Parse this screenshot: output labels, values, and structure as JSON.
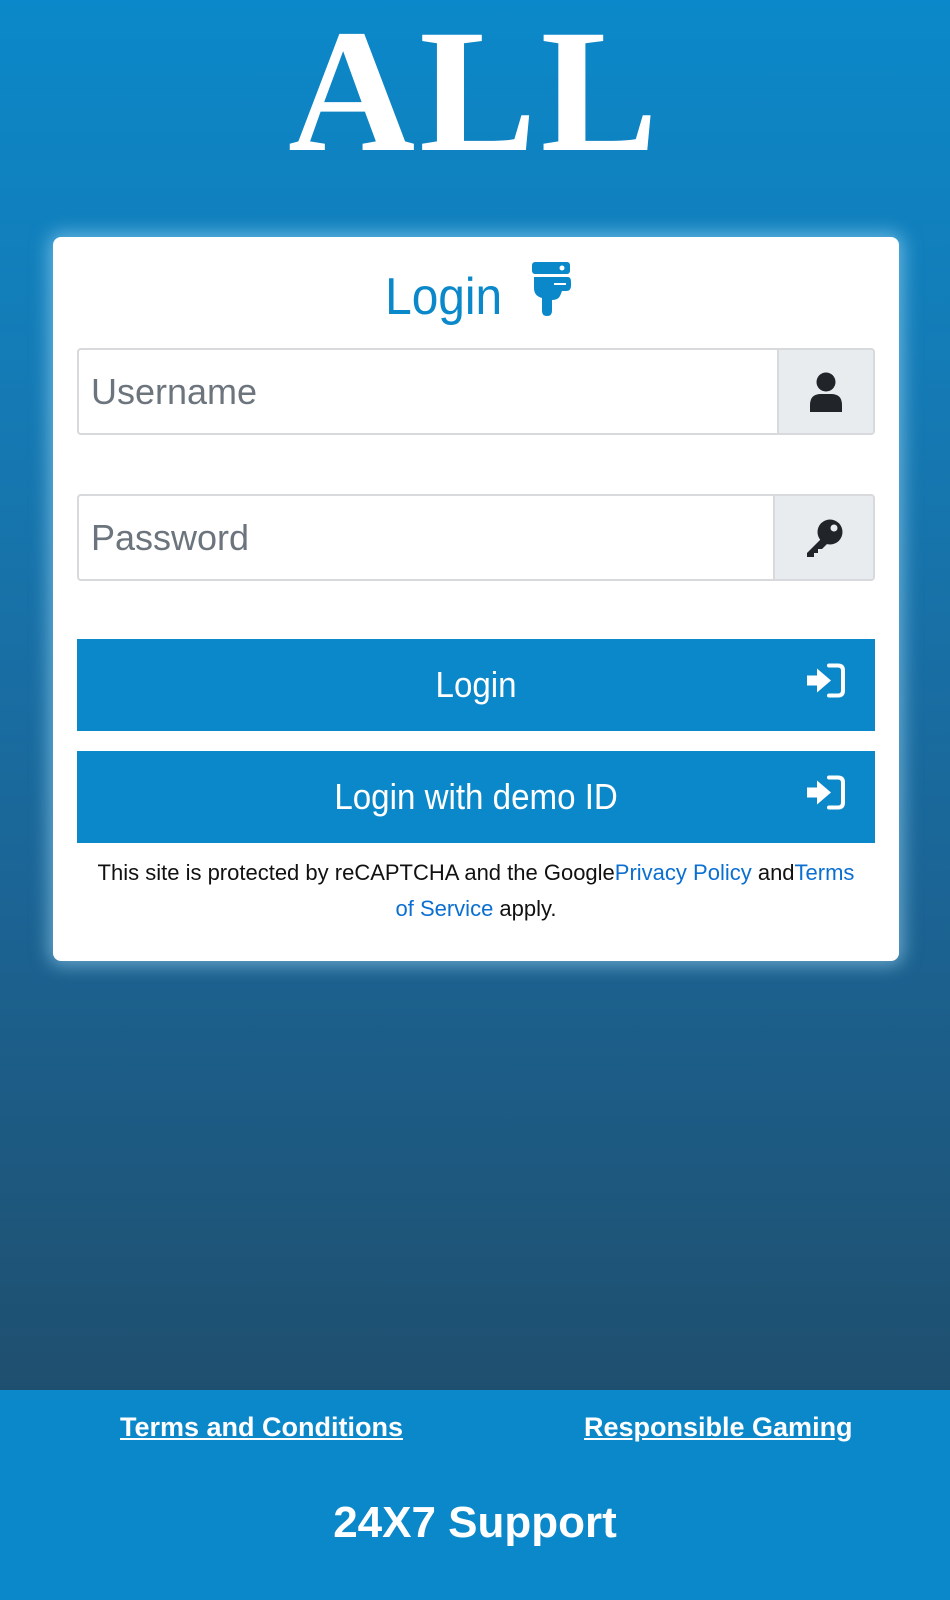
{
  "logo": {
    "text": "ALL"
  },
  "login_card": {
    "title": "Login",
    "title_icon": "hand-point-down-icon",
    "username": {
      "placeholder": "Username",
      "value": "",
      "icon": "user-icon"
    },
    "password": {
      "placeholder": "Password",
      "value": "",
      "icon": "key-icon"
    },
    "login_button": {
      "label": "Login",
      "icon": "sign-in-icon"
    },
    "demo_button": {
      "label": "Login with demo ID",
      "icon": "sign-in-icon"
    },
    "recaptcha": {
      "prefix": "This site is protected by reCAPTCHA and the Google",
      "privacy_link": "Privacy Policy",
      "middle": " and",
      "terms_link": "Terms of Service",
      "suffix": " apply."
    }
  },
  "footer": {
    "terms_link": "Terms and Conditions",
    "responsible_link": "Responsible Gaming",
    "support": "24X7 Support"
  },
  "colors": {
    "accent": "#0b88c9",
    "link": "#0b6fd1",
    "addon_bg": "#e9ecef"
  }
}
